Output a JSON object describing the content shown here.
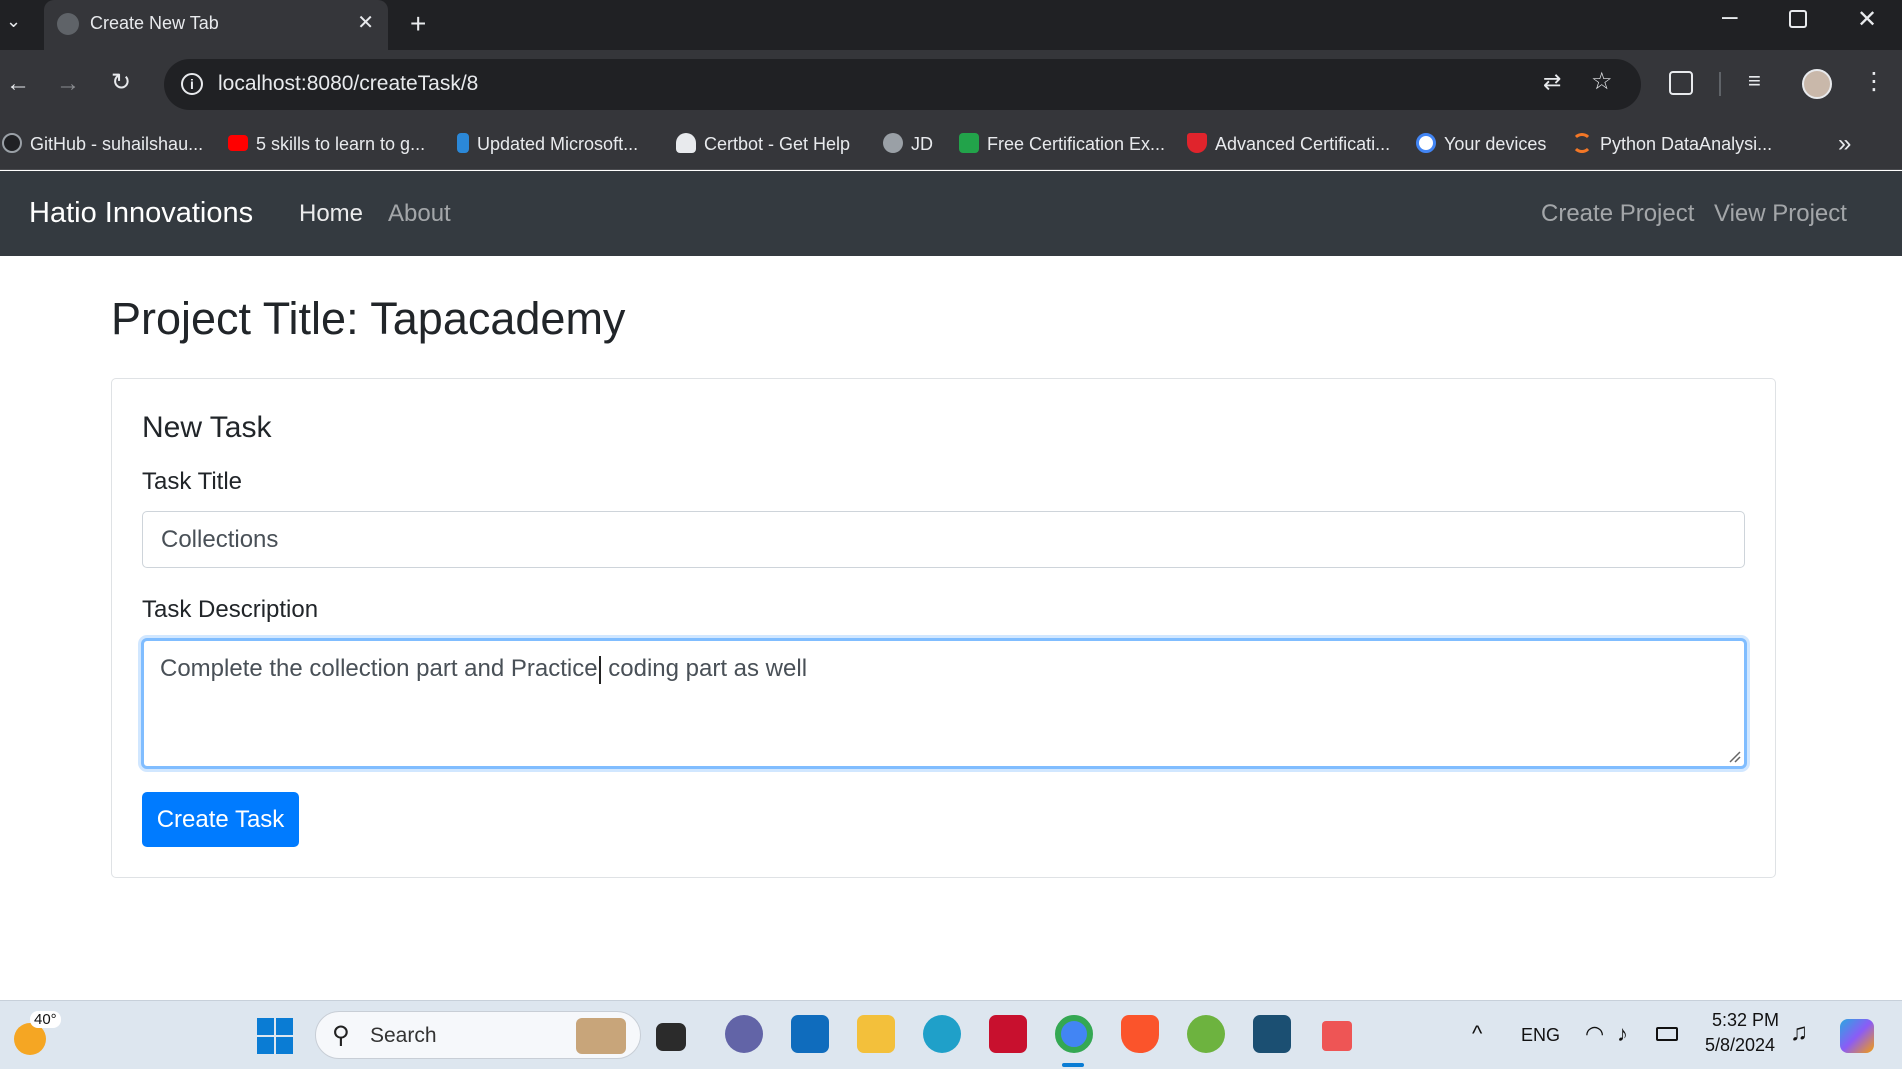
{
  "browser": {
    "tab": {
      "title": "Create New Tab",
      "close_glyph": "✕"
    },
    "new_tab_glyph": "+",
    "url": "localhost:8080/createTask/8",
    "bookmarks": [
      {
        "label": "GitHub - suhailshau...",
        "icon": "github-icon",
        "color": "#202124"
      },
      {
        "label": "5 skills to learn to g...",
        "icon": "youtube-icon",
        "color": "#ff0000"
      },
      {
        "label": "Updated Microsoft...",
        "icon": "microsoft-learn-icon",
        "color": "#2b88d8"
      },
      {
        "label": "Certbot - Get Help",
        "icon": "certbot-icon",
        "color": "#222"
      },
      {
        "label": "JD",
        "icon": "globe-icon",
        "color": "#9aa0a6"
      },
      {
        "label": "Free Certification Ex...",
        "icon": "pa-icon",
        "color": "#22a34a"
      },
      {
        "label": "Advanced Certificati...",
        "icon": "shield-icon",
        "color": "#e0242c"
      },
      {
        "label": "Your devices",
        "icon": "google-icon",
        "color": "#ffffff"
      },
      {
        "label": "Python DataAnalysi...",
        "icon": "jupyter-icon",
        "color": "#f37726"
      }
    ],
    "more_bookmarks_glyph": "»"
  },
  "navbar": {
    "brand": "Hatio Innovations",
    "links_left": [
      "Home",
      "About"
    ],
    "links_right": [
      "Create Project",
      "View Project"
    ]
  },
  "page": {
    "title": "Project Title: Tapacademy",
    "card_title": "New Task",
    "task_title_label": "Task Title",
    "task_title_value": "Collections",
    "task_description_label": "Task Description",
    "task_description_before_caret": "Complete the collection part and Practice",
    "task_description_after_caret": " coding part as well",
    "submit_label": "Create Task",
    "colors": {
      "primary": "#007bff",
      "navbar": "#343a40",
      "focus": "#80bdff"
    }
  },
  "taskbar": {
    "weather": "40°",
    "search_placeholder": "Search",
    "language": "ENG",
    "time": "5:32 PM",
    "date": "5/8/2024"
  }
}
